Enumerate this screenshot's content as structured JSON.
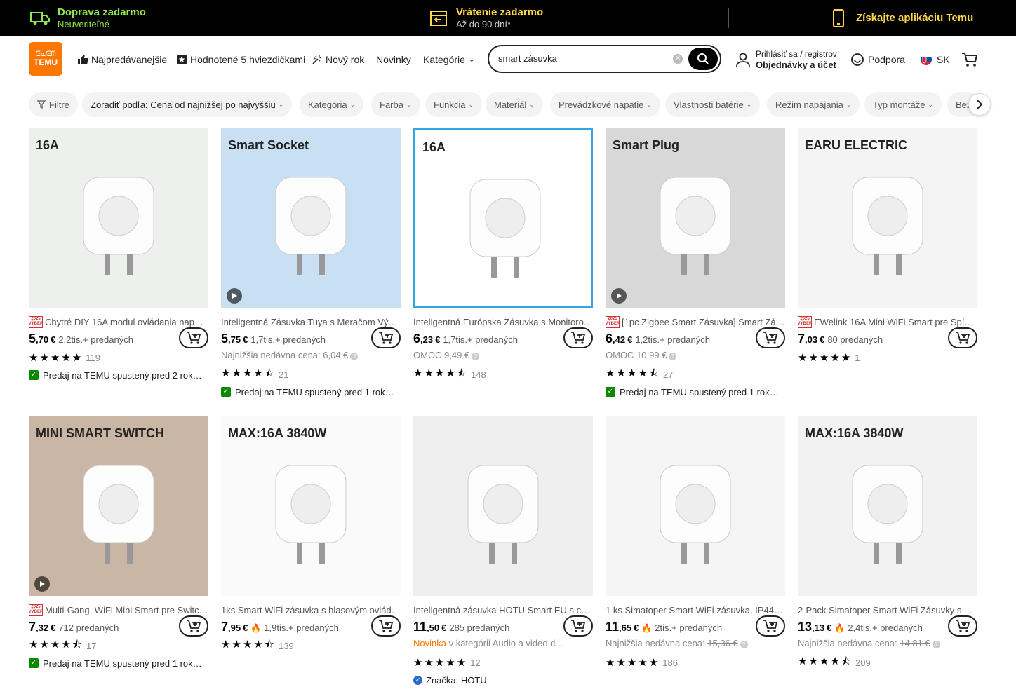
{
  "topbar": {
    "shipping_title": "Doprava zadarmo",
    "shipping_sub": "Neuveriteľné",
    "returns_title": "Vrátenie zadarmo",
    "returns_sub": "Až do 90 dní*",
    "app_label": "Získajte aplikáciu Temu",
    "accent_green": "#8ee84b",
    "accent_yellow": "#ffd84a"
  },
  "header": {
    "logo_line1": "ᕮᓇᕮᗰ",
    "logo_line2": "TEMU",
    "nav": [
      "Najpredávanejšie",
      "Hodnotené 5 hviezdičkami",
      "Nový rok",
      "Novinky",
      "Kategórie"
    ],
    "search_value": "smart zásuvka",
    "account_line1": "Prihlásiť sa / registrov",
    "account_line2": "Objednávky a účet",
    "support": "Podpora",
    "region": "SK",
    "brand_color": "#fb7701"
  },
  "filters": {
    "filter_label": "Filtre",
    "sort_label": "Zoradiť podľa: Cena od najnižšej po najvyššiu",
    "chips": [
      "Kategória",
      "Farba",
      "Funkcia",
      "Materiál",
      "Prevádzkové napätie",
      "Vlastnosti batérie",
      "Režim napájania",
      "Typ montáže",
      "Bez"
    ]
  },
  "products": [
    {
      "title": "Chytré DIY 16A modul ovládania napá…",
      "badge": "2025 VÝBER",
      "price_int": "5",
      "price_dec": ",70",
      "currency": "€",
      "sold": "2,2tis.+ predaných",
      "hot": false,
      "line2": "",
      "stars": 5,
      "rating_count": "119",
      "promo": "Predaj na TEMU spustený pred 2 rok…",
      "img_color": "#eef0ee",
      "img_text": "16A"
    },
    {
      "title": "Inteligentná Zásuvka Tuya s Meračom Výk…",
      "badge": "",
      "price_int": "5",
      "price_dec": ",75",
      "currency": "€",
      "sold": "1,7tis.+ predaných",
      "hot": false,
      "line2_label": "Najnižšia nedávna cena:",
      "line2_old": "6,04 €",
      "stars": 4.5,
      "rating_count": "21",
      "promo": "Predaj na TEMU spustený pred 1 rok…",
      "img_color": "#c9dff2",
      "img_text": "Smart Socket"
    },
    {
      "title": "Inteligentná Európska Zásuvka s Monitoro…",
      "badge": "",
      "price_int": "6",
      "price_dec": ",23",
      "currency": "€",
      "sold": "1,7tis.+ predaných",
      "hot": false,
      "line2_label": "OMOC",
      "line2_val": "9,49 €",
      "stars": 4.5,
      "rating_count": "148",
      "promo": "",
      "img_color": "#ffffff",
      "img_text": "16A"
    },
    {
      "title": "[1pc Zigbee Smart Zásuvka] Smart Zá…",
      "badge": "2025 VÝBER",
      "price_int": "6",
      "price_dec": ",42",
      "currency": "€",
      "sold": "1,2tis.+ predaných",
      "hot": false,
      "line2_label": "OMOC",
      "line2_val": "10,99 €",
      "stars": 4.5,
      "rating_count": "27",
      "promo": "Predaj na TEMU spustený pred 1 rok…",
      "img_color": "#d8d8d8",
      "img_text": "Smart Plug"
    },
    {
      "title": "EWelink 16A Mini WiFi Smart pre Spín…",
      "badge": "2025 VÝBER",
      "price_int": "7",
      "price_dec": ",03",
      "currency": "€",
      "sold": "80 predaných",
      "hot": false,
      "line2": "",
      "stars": 5,
      "rating_count": "1",
      "promo": "",
      "img_color": "#f4f4f4",
      "img_text": "EARU ELECTRIC"
    },
    {
      "title": "Multi-Gang, WiFi Mini Smart pre Switc…",
      "badge": "2025 VÝBER",
      "price_int": "7",
      "price_dec": ",32",
      "currency": "€",
      "sold": "712 predaných",
      "hot": false,
      "line2": "",
      "stars": 4.5,
      "rating_count": "17",
      "promo": "Predaj na TEMU spustený pred 1 rok…",
      "img_color": "#c9b6a4",
      "img_text": "MINI SMART SWITCH"
    },
    {
      "title": "1ks Smart WiFi zásuvka s hlasovým ovláda…",
      "badge": "",
      "price_int": "7",
      "price_dec": ",95",
      "currency": "€",
      "sold": "1,9tis.+ predaných",
      "hot": true,
      "line2": "",
      "stars": 4.5,
      "rating_count": "139",
      "promo": "",
      "img_color": "#fafafa",
      "img_text": "MAX:16A 3840W"
    },
    {
      "title": "Inteligentná zásuvka HOTU Smart EU s cel…",
      "badge": "",
      "price_int": "11",
      "price_dec": ",50",
      "currency": "€",
      "sold": "285 predaných",
      "hot": false,
      "line2_new": "Novinka",
      "line2_rest": "v kategórii Audio a video d…",
      "stars": 5,
      "rating_count": "12",
      "brand": "Značka: HOTU",
      "img_color": "#efefef",
      "img_text": ""
    },
    {
      "title": "1 ks Simatoper Smart WiFi zásuvka, IP44 v…",
      "badge": "",
      "price_int": "11",
      "price_dec": ",65",
      "currency": "€",
      "sold": "2tis.+ predaných",
      "hot": true,
      "line2_label": "Najnižšia nedávna cena:",
      "line2_old": "15,36 €",
      "stars": 5,
      "rating_count": "186",
      "promo": "",
      "img_color": "#f5f5f5",
      "img_text": ""
    },
    {
      "title": "2-Pack Simatoper Smart WiFi Zásuvky s Al…",
      "badge": "",
      "price_int": "13",
      "price_dec": ",13",
      "currency": "€",
      "sold": "2,4tis.+ predaných",
      "hot": true,
      "line2_label": "Najnižšia nedávna cena:",
      "line2_old": "14,81 €",
      "stars": 4.5,
      "rating_count": "209",
      "promo": "",
      "img_color": "#f2f2f2",
      "img_text": "MAX:16A 3840W"
    }
  ]
}
